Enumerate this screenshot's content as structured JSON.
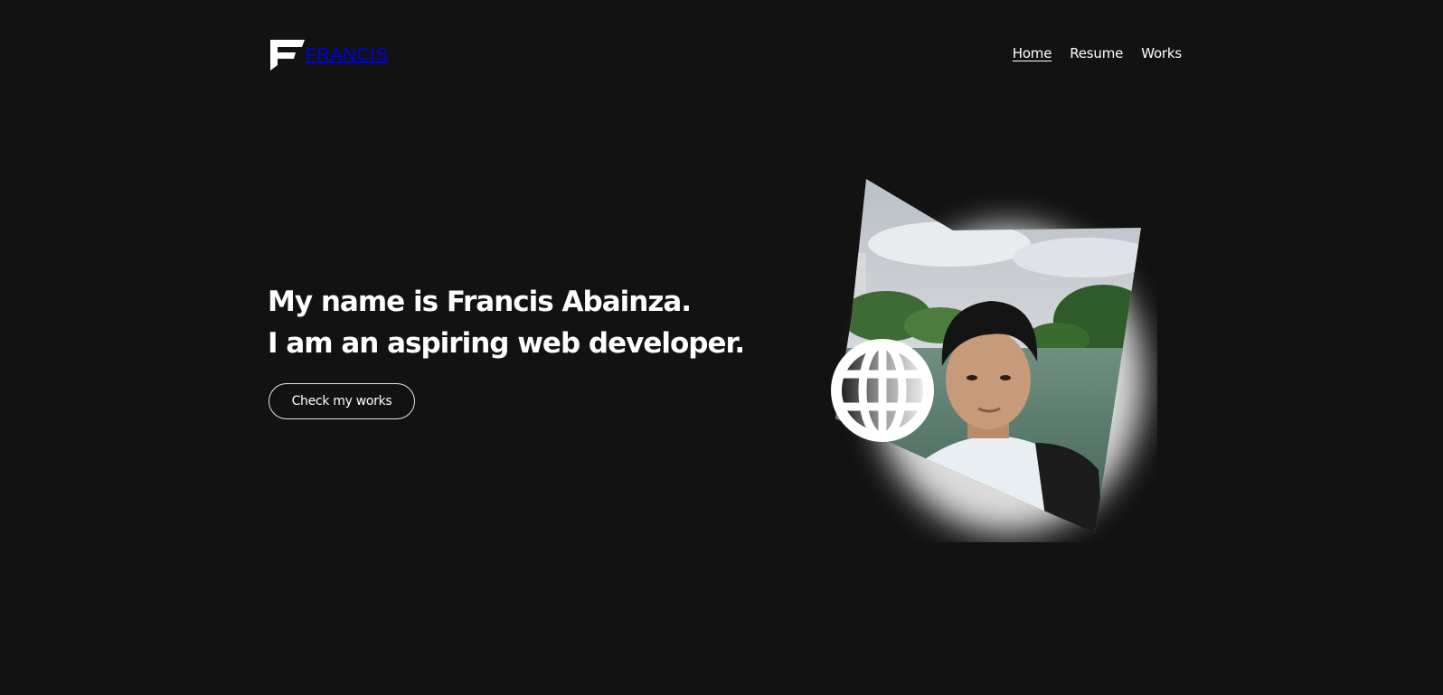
{
  "header": {
    "logo_text": "FRANCIS",
    "nav": [
      {
        "label": "Home",
        "active": true
      },
      {
        "label": "Resume",
        "active": false
      },
      {
        "label": "Works",
        "active": false
      }
    ]
  },
  "hero": {
    "line1": "My name is Francis Abainza.",
    "line2": "I am an aspiring web developer.",
    "cta_label": "Check my works"
  },
  "icons": {
    "logo": "f-logo-icon",
    "globe": "globe-icon"
  },
  "colors": {
    "background": "#121212",
    "text": "#ffffff"
  }
}
